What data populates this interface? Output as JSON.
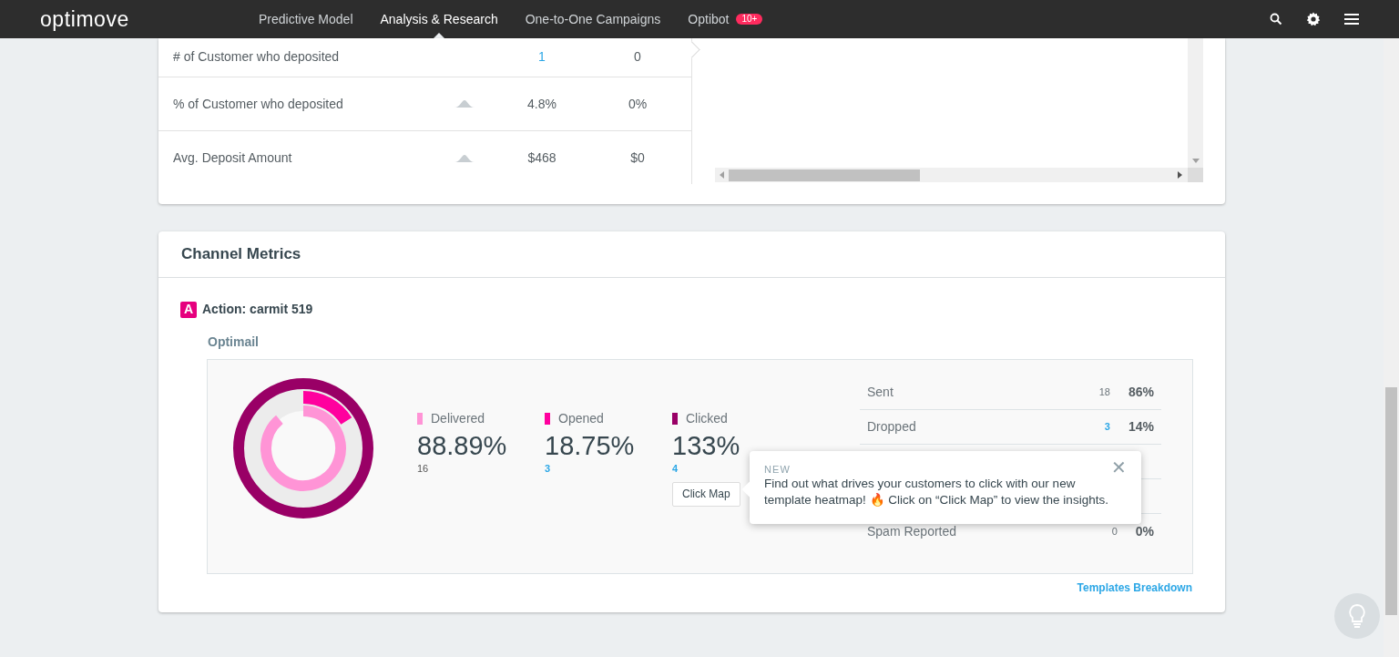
{
  "nav": {
    "logo": "optimove",
    "items": [
      {
        "label": "Predictive Model",
        "selected": false
      },
      {
        "label": "Analysis & Research",
        "selected": true
      },
      {
        "label": "One-to-One Campaigns",
        "selected": false
      },
      {
        "label": "Optibot",
        "selected": false,
        "badge": "10+"
      }
    ]
  },
  "kpi_table": {
    "rows": [
      {
        "label": "# of Customer who deposited",
        "trend": false,
        "value_1": "1",
        "value_1_link": true,
        "value_2": "0"
      },
      {
        "label": "% of Customer who deposited",
        "trend": true,
        "value_1": "4.8%",
        "value_1_link": false,
        "value_2": "0%"
      },
      {
        "label": "Avg. Deposit Amount",
        "trend": true,
        "value_1": "$468",
        "value_1_link": false,
        "value_2": "$0"
      }
    ]
  },
  "channel_metrics": {
    "title": "Channel Metrics",
    "action_badge": "A",
    "action_label": "Action: carmit 519",
    "channel": "Optimail",
    "metrics": [
      {
        "label": "Delivered",
        "color": "#ff94d6",
        "value": "88.89%",
        "count": "16",
        "count_link": false
      },
      {
        "label": "Opened",
        "color": "#ff009e",
        "value": "18.75%",
        "count": "3",
        "count_link": true
      },
      {
        "label": "Clicked",
        "color": "#990066",
        "value": "133%",
        "count": "4",
        "count_link": true
      }
    ],
    "click_map_button": "Click Map",
    "stats": [
      {
        "label": "Sent",
        "count": "18",
        "count_link": false,
        "pct": "86%"
      },
      {
        "label": "Dropped",
        "count": "3",
        "count_link": true,
        "pct": "14%"
      },
      {
        "label": "Spam Reported",
        "count": "0",
        "count_link": false,
        "pct": "0%"
      }
    ],
    "templates_link": "Templates Breakdown"
  },
  "popover": {
    "tag": "NEW",
    "text": "Find out what drives your customers to click with our new template heatmap! 🔥 Click on “Click Map” to view the insights.",
    "close": "✕"
  }
}
